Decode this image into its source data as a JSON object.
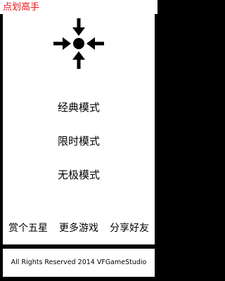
{
  "app": {
    "title": "点划高手"
  },
  "logo": {
    "icon": "arrows-converging-to-dot-icon"
  },
  "menu": {
    "items": [
      {
        "label": "经典模式"
      },
      {
        "label": "限时模式"
      },
      {
        "label": "无极模式"
      }
    ]
  },
  "bottom_bar": {
    "rate_label": "赏个五星",
    "more_games_label": "更多游戏",
    "share_label": "分享好友"
  },
  "footer": {
    "text": "All Rights Reserved 2014 VFGameStudio"
  },
  "colors": {
    "title_text": "#e8141a",
    "background": "#000000",
    "panel": "#ffffff"
  }
}
